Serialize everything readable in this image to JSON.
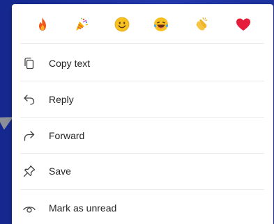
{
  "reactions": [
    {
      "icon": "fire-emoji-icon"
    },
    {
      "icon": "party-popper-emoji-icon"
    },
    {
      "icon": "smiling-face-emoji-icon"
    },
    {
      "icon": "laughing-tears-emoji-icon"
    },
    {
      "icon": "clapping-hands-emoji-icon"
    },
    {
      "icon": "red-heart-emoji-icon"
    }
  ],
  "menu": {
    "items": [
      {
        "label": "Copy text",
        "icon": "copy-icon"
      },
      {
        "label": "Reply",
        "icon": "reply-icon"
      },
      {
        "label": "Forward",
        "icon": "forward-icon"
      },
      {
        "label": "Save",
        "icon": "pin-icon"
      },
      {
        "label": "Mark as unread",
        "icon": "eye-icon"
      }
    ]
  },
  "colors": {
    "background": "#1f34a3",
    "menu_background": "#ffffff",
    "text": "#242424",
    "icon": "#424242"
  }
}
